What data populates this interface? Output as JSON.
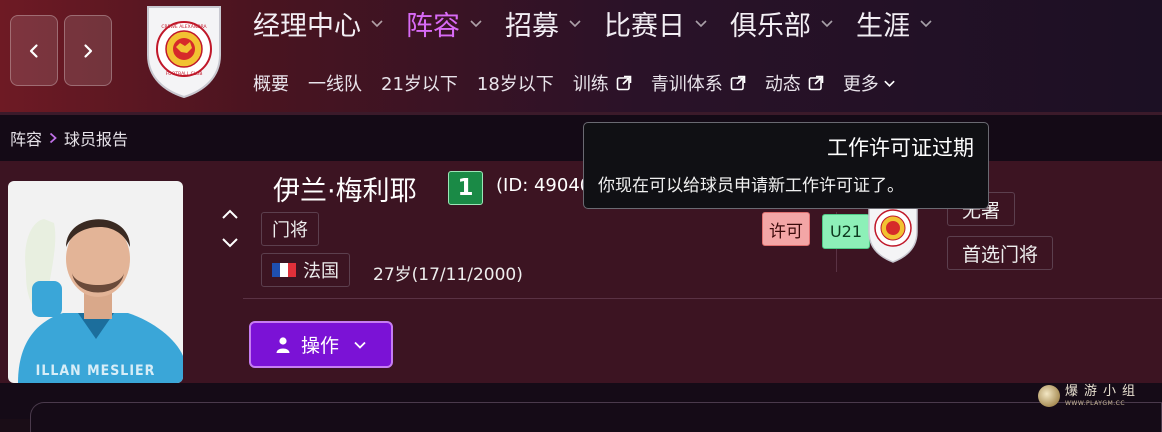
{
  "header": {
    "main_nav": [
      {
        "label": "经理中心",
        "active": false
      },
      {
        "label": "阵容",
        "active": true
      },
      {
        "label": "招募",
        "active": false
      },
      {
        "label": "比赛日",
        "active": false
      },
      {
        "label": "俱乐部",
        "active": false
      },
      {
        "label": "生涯",
        "active": false
      }
    ],
    "sub_nav": [
      {
        "label": "概要",
        "icon": null
      },
      {
        "label": "一线队",
        "icon": null
      },
      {
        "label": "21岁以下",
        "icon": null
      },
      {
        "label": "18岁以下",
        "icon": null
      },
      {
        "label": "训练",
        "icon": "external-link-icon"
      },
      {
        "label": "青训体系",
        "icon": "external-link-icon"
      },
      {
        "label": "动态",
        "icon": "external-link-icon"
      },
      {
        "label": "更多",
        "icon": "chevron-down-icon"
      }
    ],
    "crest_text": [
      "CREWE ALEXANDRA",
      "FOOTBALL CLUB"
    ]
  },
  "breadcrumb": {
    "parent": "阵容",
    "current": "球员报告"
  },
  "player": {
    "name": "伊兰·梅利耶",
    "squad_number": "1",
    "id_text": "(ID: 49040",
    "position": "门将",
    "nationality": "法国",
    "age_dob": "27岁(17/11/2000)",
    "photo_caption": "ILLAN MESLIER",
    "badges": {
      "permit": "许可",
      "u21": "U21"
    },
    "roles": [
      "无署",
      "首选门将"
    ]
  },
  "actions": {
    "label": "操作"
  },
  "tooltip": {
    "title": "工作许可证过期",
    "body": "你现在可以给球员申请新工作许可证了。"
  },
  "watermark": {
    "cn": "爆游小组",
    "en": "WWW.PLAYGM.CC"
  },
  "colors": {
    "accent_active": "#d86af5",
    "action_button": "#7b12d6",
    "squad_number": "#1a8a46",
    "permit_badge": "#f3a6a6",
    "u21_badge": "#8df0b8"
  }
}
